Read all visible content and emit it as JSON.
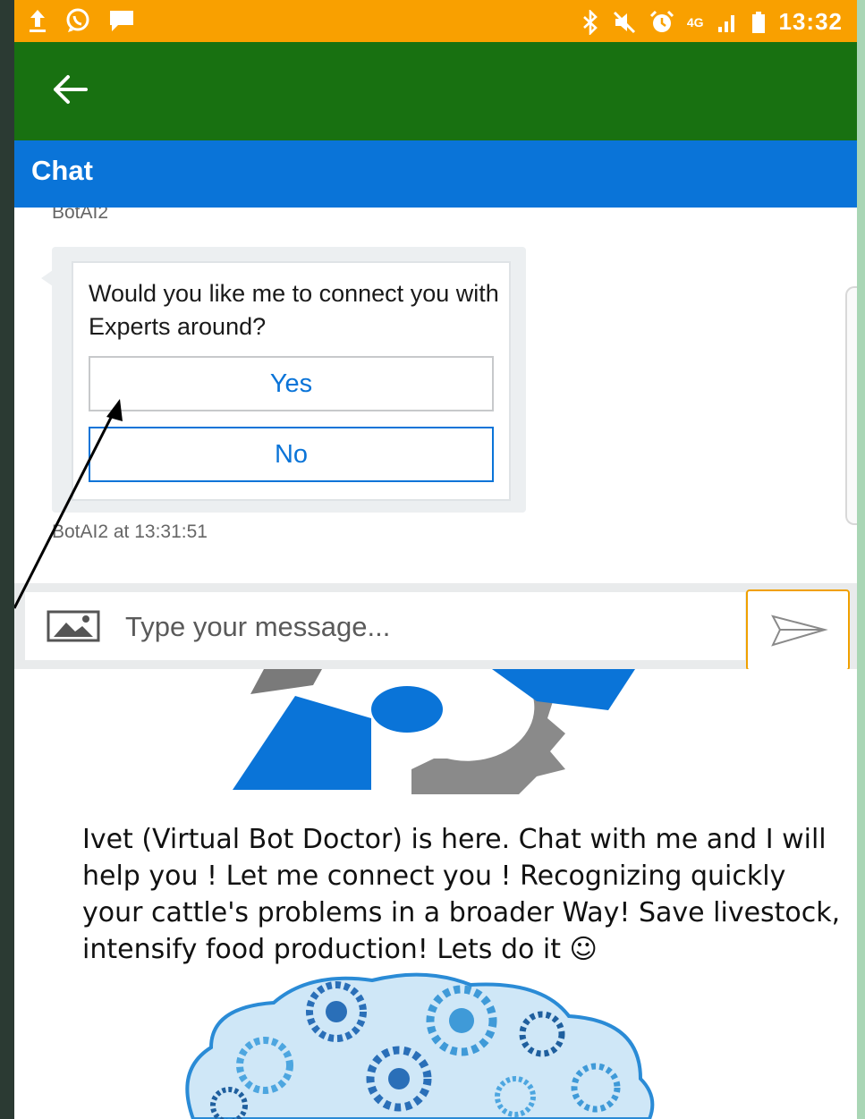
{
  "status_bar": {
    "time": "13:32",
    "network_label": "4G",
    "left_icons": [
      "upload-icon",
      "whatsapp-icon",
      "message-icon"
    ],
    "right_icons": [
      "bluetooth-icon",
      "mute-icon",
      "alarm-icon",
      "signal-icon",
      "battery-icon"
    ]
  },
  "app_bar": {
    "back_icon": "arrow-left-icon"
  },
  "chat_header": {
    "title": "Chat"
  },
  "conversation": {
    "sender_top": "BotAI2",
    "question": "Would you like me to connect you with Experts around?",
    "options": [
      {
        "label": "Yes"
      },
      {
        "label": "No"
      }
    ],
    "sender_footer": "BotAI2 at 13:31:51"
  },
  "composer": {
    "placeholder": "Type your message...",
    "image_icon": "image-icon",
    "send_icon": "send-icon"
  },
  "promo": {
    "text": "Ivet (Virtual Bot Doctor) is here. Chat with me and I will help you ! Let me connect you ! Recognizing quickly your cattle's problems in a broader Way! Save livestock, intensify food production! Lets do it ☺"
  },
  "colors": {
    "status_bar": "#f9a000",
    "app_bar": "#187111",
    "chat_header": "#0a74d8",
    "accent": "#0a74d8",
    "send_border": "#f0a000"
  }
}
